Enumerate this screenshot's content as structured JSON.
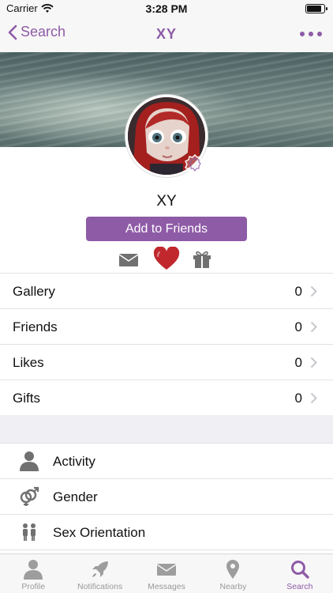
{
  "status_bar": {
    "carrier": "Carrier",
    "time": "3:28 PM",
    "battery_level": 0.8
  },
  "nav": {
    "back_label": "Search",
    "title": "XY"
  },
  "profile": {
    "name": "XY",
    "add_friends_label": "Add to Friends"
  },
  "counts": [
    {
      "label": "Gallery",
      "value": "0"
    },
    {
      "label": "Friends",
      "value": "0"
    },
    {
      "label": "Likes",
      "value": "0"
    },
    {
      "label": "Gifts",
      "value": "0"
    }
  ],
  "info": [
    {
      "label": "Activity",
      "icon": "person-icon"
    },
    {
      "label": "Gender",
      "icon": "gender-icon"
    },
    {
      "label": "Sex Orientation",
      "icon": "couple-icon"
    }
  ],
  "tabs": [
    {
      "label": "Profile",
      "icon": "person-icon"
    },
    {
      "label": "Notifications",
      "icon": "rocket-icon"
    },
    {
      "label": "Messages",
      "icon": "envelope-icon"
    },
    {
      "label": "Nearby",
      "icon": "location-pin-icon"
    },
    {
      "label": "Search",
      "icon": "search-icon",
      "active": true
    }
  ],
  "colors": {
    "accent": "#8e5ba6",
    "heart": "#c0282d",
    "icon_gray": "#7a7a7a",
    "tab_inactive": "#999999"
  }
}
